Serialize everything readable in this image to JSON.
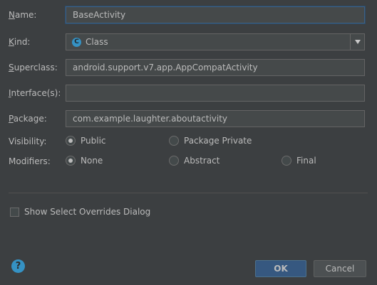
{
  "name": {
    "label_ul": "N",
    "label_rest": "ame:",
    "value": "BaseActivity"
  },
  "kind": {
    "label_ul": "K",
    "label_rest": "ind:",
    "value": "Class",
    "icon": "class-icon"
  },
  "superclass": {
    "label_ul": "S",
    "label_rest": "uperclass:",
    "value": "android.support.v7.app.AppCompatActivity"
  },
  "interfaces": {
    "label_ul": "I",
    "label_rest": "nterface(s):",
    "value": ""
  },
  "package": {
    "label_ul": "P",
    "label_rest": "ackage:",
    "value": "com.example.laughter.aboutactivity"
  },
  "visibility": {
    "label": "Visibility:",
    "options": [
      {
        "label": "Public",
        "checked": true
      },
      {
        "label": "Package Private",
        "checked": false
      }
    ]
  },
  "modifiers": {
    "label": "Modifiers:",
    "options": [
      {
        "label": "None",
        "checked": true
      },
      {
        "label": "Abstract",
        "checked": false
      },
      {
        "label": "Final",
        "checked": false
      }
    ]
  },
  "overrides": {
    "label": "Show Select Overrides Dialog",
    "checked": false
  },
  "buttons": {
    "ok": "OK",
    "cancel": "Cancel"
  },
  "help": "?"
}
